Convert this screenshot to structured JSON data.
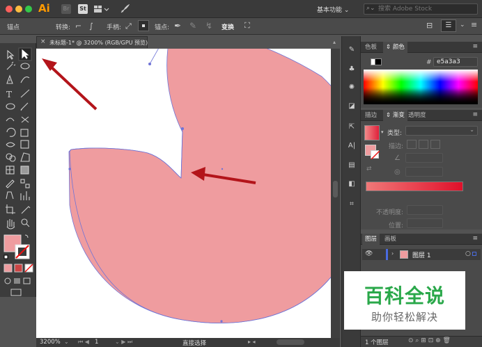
{
  "titlebar": {
    "app_logo": "Ai",
    "bridge_icon": "Br",
    "stock_icon": "St",
    "workspace": "基本功能",
    "search_placeholder": "搜索 Adobe Stock"
  },
  "controlbar": {
    "tool_label": "锚点",
    "convert_label": "转换:",
    "handle_label": "手柄:",
    "anchor_label": "锚点:",
    "transform_label": "变换"
  },
  "document": {
    "tab_title": "未标题-1* @ 3200% (RGB/GPU 预览)"
  },
  "statusbar": {
    "zoom": "3200%",
    "artboard": "1",
    "tool_name": "直接选择"
  },
  "color_panel": {
    "tab_swatches": "色板",
    "tab_color": "颜色",
    "hex_value": "e5a3a3"
  },
  "gradient_panel": {
    "tab_stroke": "描边",
    "tab_gradient": "渐变",
    "tab_transparency": "透明度",
    "type_label": "类型:",
    "stroke_label": "描边:",
    "opacity_label": "不透明度:",
    "position_label": "位置:"
  },
  "layers_panel": {
    "tab_layers": "图层",
    "tab_artboards": "画板",
    "layer_name": "图层 1",
    "footer_count": "1 个图层"
  },
  "watermark": {
    "title": "百科全说",
    "subtitle": "助你轻松解决"
  },
  "colors": {
    "shape_fill": "#ef9c9f",
    "path_stroke": "#6f73d6",
    "arrow": "#b3141a",
    "watermark_green": "#2aa84a"
  }
}
